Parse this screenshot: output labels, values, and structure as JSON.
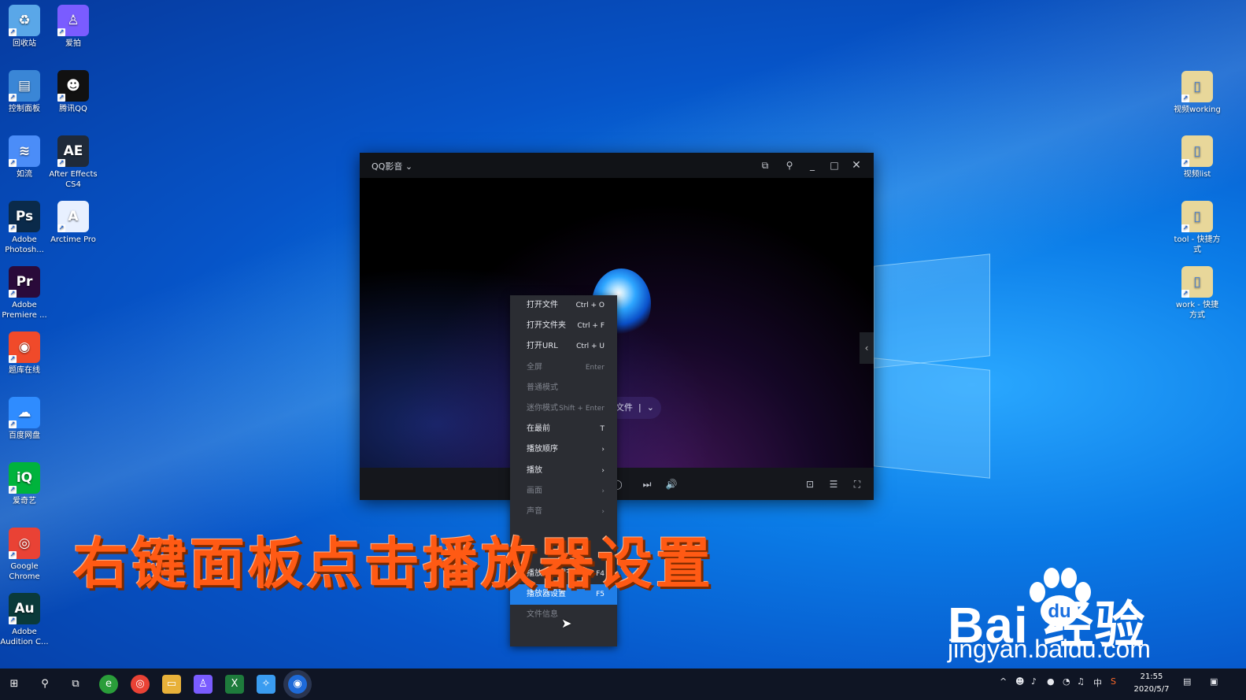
{
  "desktop": {
    "left_icons": [
      {
        "label": "回收站",
        "icon": "recycle-bin-icon",
        "color": "#5aa7e8",
        "glyph": "♻"
      },
      {
        "label": "爱拍",
        "icon": "aipai-icon",
        "color": "#7a5cff",
        "glyph": "♙"
      },
      {
        "label": "控制面板",
        "icon": "control-panel-icon",
        "color": "#3a86d6",
        "glyph": "▤"
      },
      {
        "label": "腾讯QQ",
        "icon": "qq-penguin-icon",
        "color": "#111111",
        "glyph": "☻"
      },
      {
        "label": "如流",
        "icon": "ruliu-icon",
        "color": "#4b8df8",
        "glyph": "≋"
      },
      {
        "label": "After Effects CS4",
        "icon": "after-effects-icon",
        "color": "#1f2a3a",
        "glyph": "AE"
      },
      {
        "label": "Adobe Photosh...",
        "icon": "photoshop-icon",
        "color": "#0a2a4a",
        "glyph": "Ps"
      },
      {
        "label": "Arctime Pro",
        "icon": "arctime-icon",
        "color": "#e8f0ff",
        "glyph": "A"
      },
      {
        "label": "Adobe Premiere ...",
        "icon": "premiere-icon",
        "color": "#2a0a3a",
        "glyph": "Pr"
      },
      {
        "label": "题库在线",
        "icon": "tiku-icon",
        "color": "#f04a2a",
        "glyph": "◉"
      },
      {
        "label": "百度网盘",
        "icon": "baidu-netdisk-icon",
        "color": "#2f8cff",
        "glyph": "☁"
      },
      {
        "label": "爱奇艺",
        "icon": "iqiyi-icon",
        "color": "#00b33c",
        "glyph": "iQ"
      },
      {
        "label": "Google Chrome",
        "icon": "chrome-icon",
        "color": "#e94235",
        "glyph": "◎"
      },
      {
        "label": "Adobe Audition C...",
        "icon": "audition-icon",
        "color": "#0a3a3a",
        "glyph": "Au"
      }
    ],
    "right_icons": [
      {
        "label": "视频working",
        "icon": "folder-icon",
        "color": "#e8d79a",
        "glyph": "▯"
      },
      {
        "label": "视频list",
        "icon": "folder-icon",
        "color": "#e8d79a",
        "glyph": "▯"
      },
      {
        "label": "tool - 快捷方式",
        "icon": "folder-shortcut-icon",
        "color": "#e8d79a",
        "glyph": "▯"
      },
      {
        "label": "work - 快捷方式",
        "icon": "folder-shortcut-icon",
        "color": "#e8d79a",
        "glyph": "▯"
      }
    ]
  },
  "player": {
    "app_name": "QQ影音",
    "open_file_hint": "文件",
    "title_buttons": [
      "screenshot-icon",
      "pin-icon",
      "minimize-icon",
      "maximize-icon",
      "close-icon"
    ]
  },
  "context_menu": {
    "items": [
      {
        "label": "打开文件",
        "shortcut": "Ctrl + O",
        "state": "on"
      },
      {
        "label": "打开文件夹",
        "shortcut": "Ctrl + F",
        "state": "on"
      },
      {
        "label": "打开URL",
        "shortcut": "Ctrl + U",
        "state": "on"
      },
      {
        "label": "全屏",
        "shortcut": "Enter",
        "state": "off"
      },
      {
        "label": "普通模式",
        "shortcut": "",
        "state": "off"
      },
      {
        "label": "迷你模式",
        "shortcut": "Shift + Enter",
        "state": "off"
      },
      {
        "label": "在最前",
        "shortcut": "T",
        "state": "on"
      },
      {
        "label": "播放顺序",
        "shortcut": "›",
        "state": "on"
      },
      {
        "label": "播放",
        "shortcut": "›",
        "state": "on"
      },
      {
        "label": "画面",
        "shortcut": "›",
        "state": "off"
      },
      {
        "label": "声音",
        "shortcut": "›",
        "state": "off"
      },
      {
        "label": "",
        "shortcut": "",
        "state": "off"
      },
      {
        "label": "",
        "shortcut": "",
        "state": "off"
      },
      {
        "label": "播放效果调节",
        "shortcut": "F4",
        "state": "on"
      },
      {
        "label": "播放器设置",
        "shortcut": "F5",
        "state": "sel"
      },
      {
        "label": "文件信息",
        "shortcut": "",
        "state": "off"
      }
    ]
  },
  "caption": "右键面板点击播放器设置",
  "watermark": {
    "logo_text": "Bai  经验",
    "url": "jingyan.baidu.com"
  },
  "taskbar": {
    "tray_lang": "中",
    "time": "21:55",
    "date": "2020/5/7"
  }
}
